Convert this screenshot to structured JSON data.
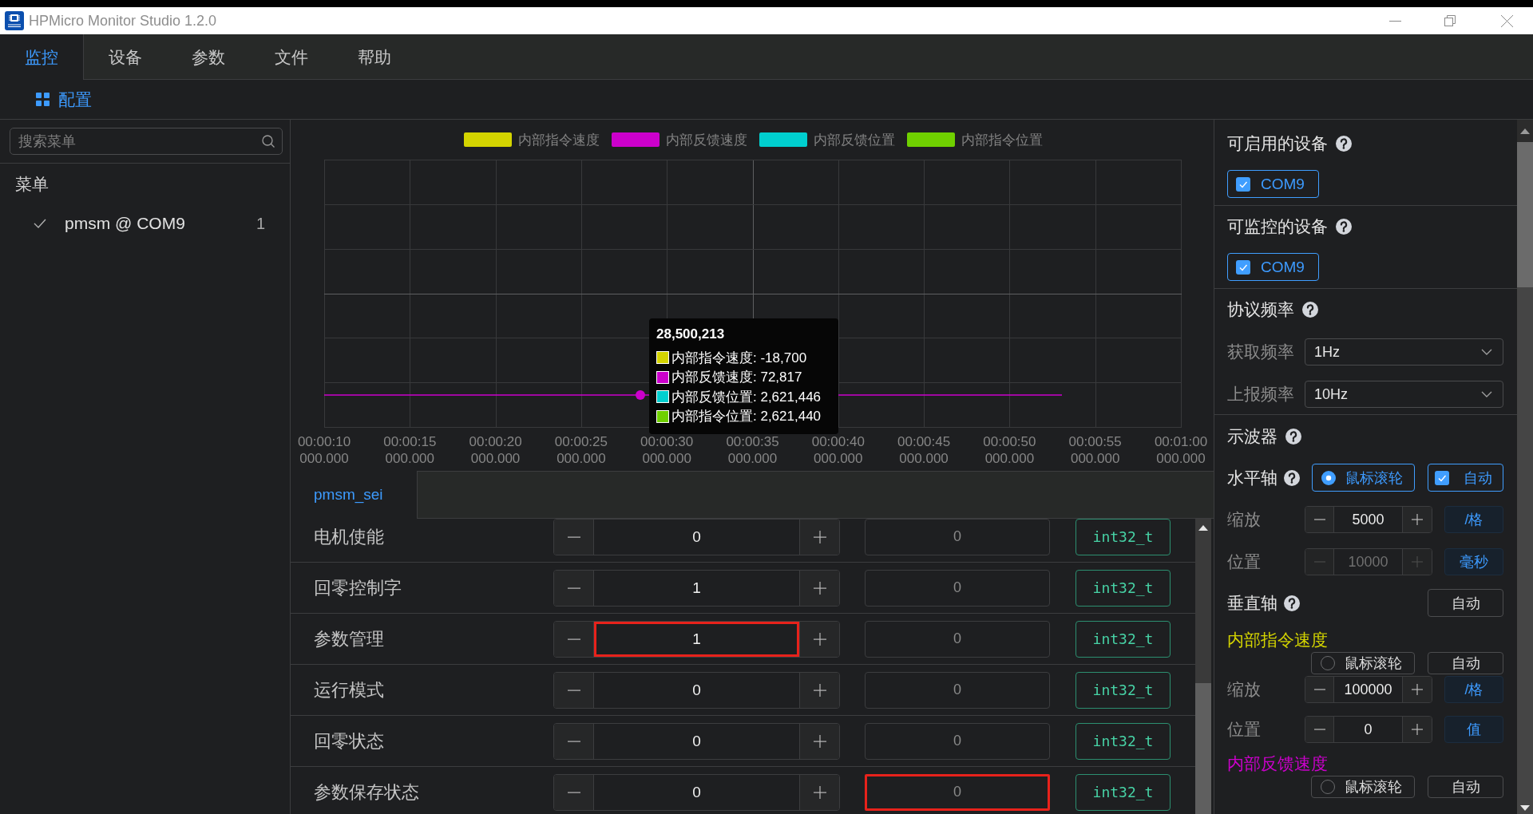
{
  "window": {
    "title": "HPMicro Monitor Studio 1.2.0"
  },
  "menu_tabs": [
    {
      "label": "监控",
      "selected": true
    },
    {
      "label": "设备",
      "selected": false
    },
    {
      "label": "参数",
      "selected": false
    },
    {
      "label": "文件",
      "selected": false
    },
    {
      "label": "帮助",
      "selected": false
    }
  ],
  "toolbar": {
    "config_button": "配置"
  },
  "sidebar": {
    "search": {
      "placeholder": "搜索菜单"
    },
    "heading": "菜单",
    "items": [
      {
        "label": "pmsm @ COM9",
        "count": "1",
        "checked": true
      }
    ]
  },
  "chart": {
    "legend": [
      {
        "name": "内部指令速度",
        "color": "#d4d400",
        "line_visible": false
      },
      {
        "name": "内部反馈速度",
        "color": "#cc00cc",
        "line_visible": true
      },
      {
        "name": "内部反馈位置",
        "color": "#00cfcf",
        "line_visible": false
      },
      {
        "name": "内部指令位置",
        "color": "#6fd000",
        "line_visible": false
      }
    ],
    "x_axis_labels": [
      "00:00:10\n000.000",
      "00:00:15\n000.000",
      "00:00:20\n000.000",
      "00:00:25\n000.000",
      "00:00:30\n000.000",
      "00:00:35\n000.000",
      "00:00:40\n000.000",
      "00:00:45\n000.000",
      "00:00:50\n000.000",
      "00:00:55\n000.000",
      "00:01:00\n000.000"
    ],
    "tooltip": {
      "title": "28,500,213",
      "items": [
        {
          "text": "内部指令速度: -18,700",
          "color": "#d4d400"
        },
        {
          "text": "内部反馈速度: 72,817",
          "color": "#cc00cc"
        },
        {
          "text": "内部反馈位置: 2,621,446",
          "color": "#00cfcf"
        },
        {
          "text": "内部指令位置: 2,621,440",
          "color": "#6fd000"
        }
      ]
    }
  },
  "device_tabs": [
    {
      "label": "pmsm_sei",
      "selected": true
    }
  ],
  "variables": [
    {
      "name": "电机使能",
      "value": "0",
      "readout": "0",
      "type": "int32_t",
      "value_highlighted": false,
      "readout_highlighted": false
    },
    {
      "name": "回零控制字",
      "value": "1",
      "readout": "0",
      "type": "int32_t",
      "value_highlighted": false,
      "readout_highlighted": false
    },
    {
      "name": "参数管理",
      "value": "1",
      "readout": "0",
      "type": "int32_t",
      "value_highlighted": true,
      "readout_highlighted": false
    },
    {
      "name": "运行模式",
      "value": "0",
      "readout": "0",
      "type": "int32_t",
      "value_highlighted": false,
      "readout_highlighted": false
    },
    {
      "name": "回零状态",
      "value": "0",
      "readout": "0",
      "type": "int32_t",
      "value_highlighted": false,
      "readout_highlighted": false
    },
    {
      "name": "参数保存状态",
      "value": "0",
      "readout": "0",
      "type": "int32_t",
      "value_highlighted": false,
      "readout_highlighted": true
    }
  ],
  "settings": {
    "enable_devices": {
      "title": "可启用的设备",
      "devices": [
        {
          "label": "COM9",
          "checked": true
        }
      ]
    },
    "monitor_devices": {
      "title": "可监控的设备",
      "devices": [
        {
          "label": "COM9",
          "checked": true
        }
      ]
    },
    "protocol_rate": {
      "title": "协议频率",
      "fields": [
        {
          "label": "获取频率",
          "value": "1Hz"
        },
        {
          "label": "上报频率",
          "value": "10Hz"
        }
      ]
    },
    "oscilloscope": {
      "title": "示波器",
      "horizontal_axis": {
        "title": "水平轴",
        "mouse_wheel": {
          "label": "鼠标滚轮",
          "selected": true
        },
        "auto": {
          "label": "自动",
          "checked": true
        },
        "zoom": {
          "label": "缩放",
          "value": "5000",
          "unit": "/格",
          "disabled": false
        },
        "position": {
          "label": "位置",
          "value": "10000",
          "unit": "毫秒",
          "disabled": true
        }
      },
      "vertical_axis": {
        "title": "垂直轴",
        "auto_button": "自动",
        "series": [
          {
            "name": "内部指令速度",
            "color": "#d4d400",
            "mouse_wheel": {
              "label": "鼠标滚轮",
              "selected": false
            },
            "auto_button": "自动",
            "zoom": {
              "label": "缩放",
              "value": "100000",
              "unit": "/格",
              "disabled": false
            },
            "position": {
              "label": "位置",
              "value": "0",
              "unit": "值",
              "disabled": false
            }
          },
          {
            "name": "内部反馈速度",
            "color": "#cc00cc",
            "mouse_wheel": {
              "label": "鼠标滚轮",
              "selected": false
            },
            "auto_button": "自动"
          }
        ]
      }
    }
  }
}
